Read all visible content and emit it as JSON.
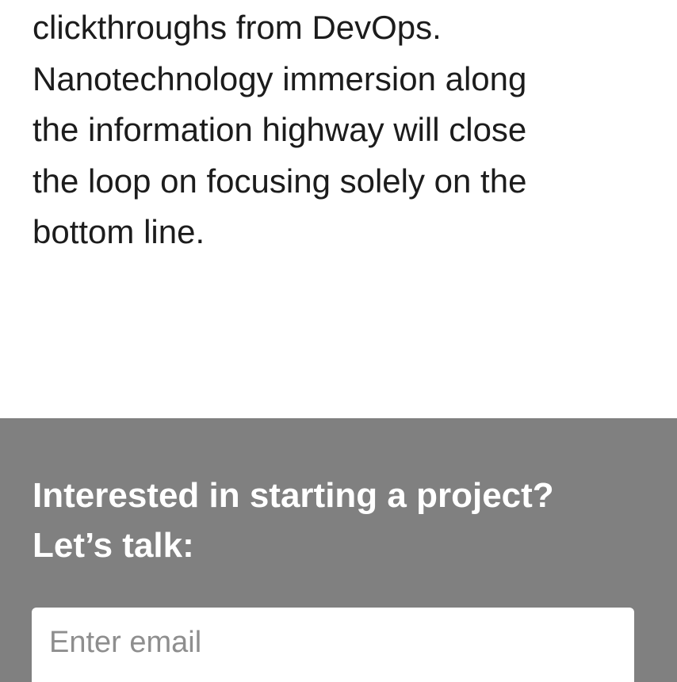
{
  "article": {
    "paragraph_lines": [
      "clickthroughs from DevOps.",
      "Nanotechnology immersion along",
      "the information highway will close",
      "the loop on focusing solely on the",
      "bottom line."
    ]
  },
  "cta": {
    "heading_lines": [
      "Interested in starting a project?",
      "Let’s talk:"
    ],
    "email_placeholder": "Enter email",
    "background_color": "#808080"
  }
}
